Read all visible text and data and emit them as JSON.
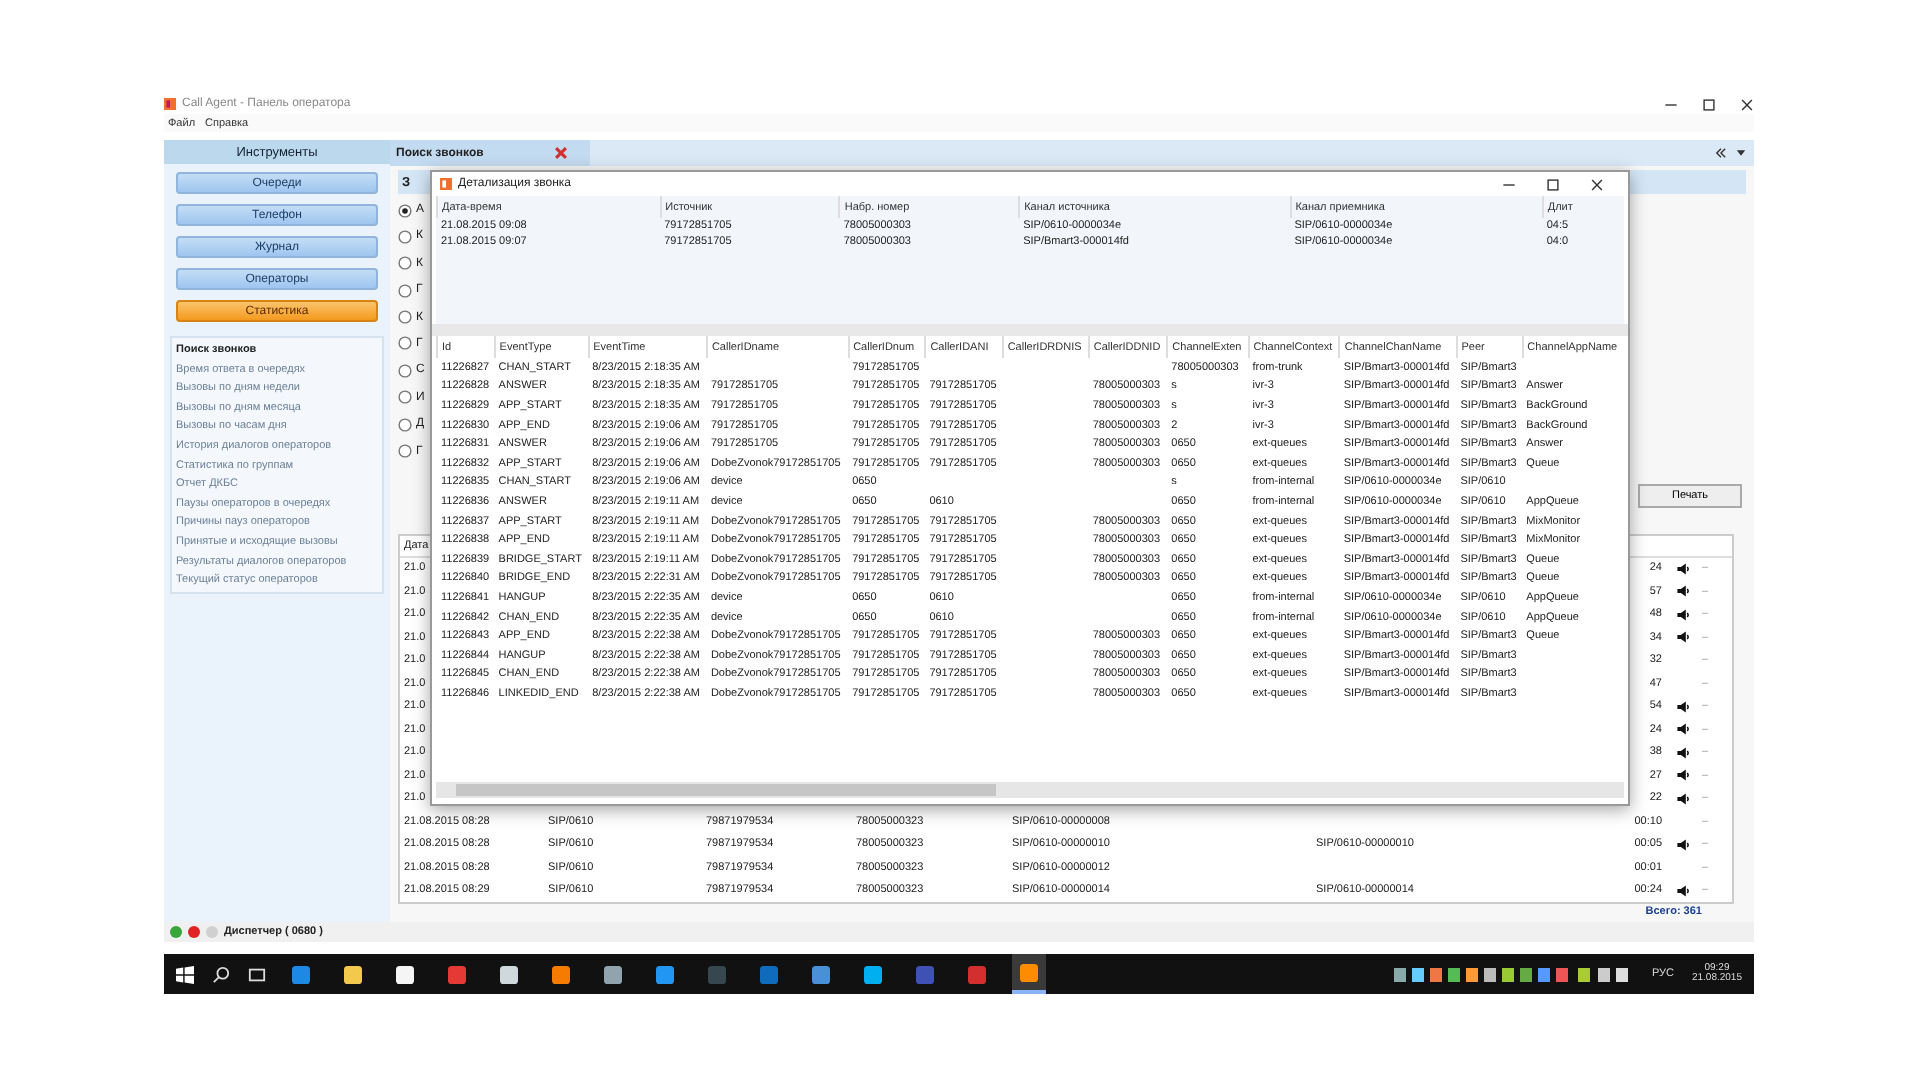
{
  "window": {
    "title": "Call Agent - Панель оператора"
  },
  "menu": [
    {
      "label": "Файл"
    },
    {
      "label": "Справка"
    }
  ],
  "sidebar": {
    "title": "Инструменты",
    "buttons": [
      {
        "label": "Очереди",
        "selected": false
      },
      {
        "label": "Телефон",
        "selected": false
      },
      {
        "label": "Журнал",
        "selected": false
      },
      {
        "label": "Операторы",
        "selected": false
      },
      {
        "label": "Статистика",
        "selected": true
      }
    ],
    "reports": [
      {
        "label": "Поиск звонков",
        "selected": true
      },
      {
        "label": "Время ответа в очередях",
        "selected": false
      },
      {
        "label": "Вызовы по дням недели",
        "selected": false
      },
      {
        "label": "Вызовы по дням месяца",
        "selected": false
      },
      {
        "label": "Вызовы по часам дня",
        "selected": false
      },
      {
        "label": "История диалогов операторов",
        "selected": false
      },
      {
        "label": "Статистика по группам",
        "selected": false
      },
      {
        "label": "Отчет ДКБС",
        "selected": false
      },
      {
        "label": "Паузы операторов в очередях",
        "selected": false
      },
      {
        "label": "Причины пауз операторов",
        "selected": false
      },
      {
        "label": "Принятые и исходящие вызовы",
        "selected": false
      },
      {
        "label": "Результаты диалогов операторов",
        "selected": false
      },
      {
        "label": "Текущий статус операторов",
        "selected": false
      }
    ]
  },
  "tabs": [
    {
      "label": "Поиск звонков",
      "selected": true
    }
  ],
  "search": {
    "heading": "З",
    "options": [
      {
        "label": "А",
        "selected": true
      },
      {
        "label": "К",
        "selected": false
      },
      {
        "label": "К",
        "selected": false
      },
      {
        "label": "Г",
        "selected": false
      },
      {
        "label": "К",
        "selected": false
      },
      {
        "label": "Г",
        "selected": false
      },
      {
        "label": "С",
        "selected": false
      },
      {
        "label": "И",
        "selected": false
      },
      {
        "label": "Д",
        "selected": false
      },
      {
        "label": "Г",
        "selected": false
      }
    ],
    "print_button": "Печать",
    "results": {
      "columns": [
        "Дата"
      ],
      "rows": [
        {
          "date": "21.0",
          "duration": "24",
          "has_audio": true,
          "mark": "–"
        },
        {
          "date": "21.0",
          "duration": "57",
          "has_audio": true,
          "mark": "–"
        },
        {
          "date": "21.0",
          "duration": "48",
          "has_audio": true,
          "mark": "–"
        },
        {
          "date": "21.0",
          "duration": "34",
          "has_audio": true,
          "mark": "–"
        },
        {
          "date": "21.0",
          "duration": "32",
          "has_audio": false,
          "mark": "–"
        },
        {
          "date": "21.0",
          "duration": "47",
          "has_audio": false,
          "mark": "–"
        },
        {
          "date": "21.0",
          "duration": "54",
          "has_audio": true,
          "mark": "–"
        },
        {
          "date": "21.0",
          "duration": "24",
          "has_audio": true,
          "mark": "–"
        },
        {
          "date": "21.0",
          "duration": "38",
          "has_audio": true,
          "mark": "–"
        },
        {
          "date": "21.0",
          "duration": "27",
          "has_audio": true,
          "mark": "–"
        },
        {
          "date": "21.0",
          "duration": "22",
          "has_audio": true,
          "mark": "–"
        },
        {
          "date": "21.08.2015 08:28",
          "source": "SIP/0610",
          "number": "79871979534",
          "dialed": "78005000323",
          "channel": "SIP/0610-00000008",
          "duration": "00:10",
          "has_audio": false,
          "mark": "–"
        },
        {
          "date": "21.08.2015 08:28",
          "source": "SIP/0610",
          "number": "79871979534",
          "dialed": "78005000323",
          "channel": "SIP/0610-00000010",
          "target": "SIP/0610-00000010",
          "duration": "00:05",
          "has_audio": true,
          "mark": "–"
        },
        {
          "date": "21.08.2015 08:28",
          "source": "SIP/0610",
          "number": "79871979534",
          "dialed": "78005000323",
          "channel": "SIP/0610-00000012",
          "duration": "00:01",
          "has_audio": false,
          "mark": "–"
        },
        {
          "date": "21.08.2015 08:29",
          "source": "SIP/0610",
          "number": "79871979534",
          "dialed": "78005000323",
          "channel": "SIP/0610-00000014",
          "target": "SIP/0610-00000014",
          "duration": "00:24",
          "has_audio": true,
          "mark": "–"
        }
      ]
    },
    "total": "Всего: 361"
  },
  "dialog": {
    "title": "Детализация звонка",
    "calls": {
      "columns": [
        "Дата-время",
        "Источник",
        "Набр. номер",
        "Канал источника",
        "Канал приемника",
        "Длит"
      ],
      "rows": [
        [
          "21.08.2015 09:08",
          "79172851705",
          "78005000303",
          "SIP/0610-0000034e",
          "SIP/0610-0000034e",
          "04:5"
        ],
        [
          "21.08.2015 09:07",
          "79172851705",
          "78005000303",
          "SIP/Bmart3-000014fd",
          "SIP/0610-0000034e",
          "04:0"
        ]
      ]
    },
    "events": {
      "columns": [
        "Id",
        "EventType",
        "EventTime",
        "CallerIDname",
        "CallerIDnum",
        "CallerIDANI",
        "CallerIDRDNIS",
        "CallerIDDNID",
        "ChannelExten",
        "ChannelContext",
        "ChannelChanName",
        "Peer",
        "ChannelAppName"
      ],
      "rows": [
        {
          "id": "11226827",
          "type": "CHAN_START",
          "time": "8/23/2015 2:18:35 AM",
          "num": "79172851705",
          "exten": "78005000303",
          "ctx": "from-trunk",
          "chan": "SIP/Bmart3-000014fd",
          "peer": "SIP/Bmart3"
        },
        {
          "id": "11226828",
          "type": "ANSWER",
          "time": "8/23/2015 2:18:35 AM",
          "name": "79172851705",
          "num": "79172851705",
          "ani": "79172851705",
          "dnid": "78005000303",
          "exten": "s",
          "ctx": "ivr-3",
          "chan": "SIP/Bmart3-000014fd",
          "peer": "SIP/Bmart3",
          "app": "Answer"
        },
        {
          "id": "11226829",
          "type": "APP_START",
          "time": "8/23/2015 2:18:35 AM",
          "name": "79172851705",
          "num": "79172851705",
          "ani": "79172851705",
          "dnid": "78005000303",
          "exten": "s",
          "ctx": "ivr-3",
          "chan": "SIP/Bmart3-000014fd",
          "peer": "SIP/Bmart3",
          "app": "BackGround"
        },
        {
          "id": "11226830",
          "type": "APP_END",
          "time": "8/23/2015 2:19:06 AM",
          "name": "79172851705",
          "num": "79172851705",
          "ani": "79172851705",
          "dnid": "78005000303",
          "exten": "2",
          "ctx": "ivr-3",
          "chan": "SIP/Bmart3-000014fd",
          "peer": "SIP/Bmart3",
          "app": "BackGround"
        },
        {
          "id": "11226831",
          "type": "ANSWER",
          "time": "8/23/2015 2:19:06 AM",
          "name": "79172851705",
          "num": "79172851705",
          "ani": "79172851705",
          "dnid": "78005000303",
          "exten": "0650",
          "ctx": "ext-queues",
          "chan": "SIP/Bmart3-000014fd",
          "peer": "SIP/Bmart3",
          "app": "Answer"
        },
        {
          "id": "11226832",
          "type": "APP_START",
          "time": "8/23/2015 2:19:06 AM",
          "name": "DobeZvonok79172851705",
          "num": "79172851705",
          "ani": "79172851705",
          "dnid": "78005000303",
          "exten": "0650",
          "ctx": "ext-queues",
          "chan": "SIP/Bmart3-000014fd",
          "peer": "SIP/Bmart3",
          "app": "Queue"
        },
        {
          "id": "11226835",
          "type": "CHAN_START",
          "time": "8/23/2015 2:19:06 AM",
          "name": "device",
          "num": "0650",
          "exten": "s",
          "ctx": "from-internal",
          "chan": "SIP/0610-0000034e",
          "peer": "SIP/0610"
        },
        {
          "id": "11226836",
          "type": "ANSWER",
          "time": "8/23/2015 2:19:11 AM",
          "name": "device",
          "num": "0650",
          "ani": "0610",
          "exten": "0650",
          "ctx": "from-internal",
          "chan": "SIP/0610-0000034e",
          "peer": "SIP/0610",
          "app": "AppQueue"
        },
        {
          "id": "11226837",
          "type": "APP_START",
          "time": "8/23/2015 2:19:11 AM",
          "name": "DobeZvonok79172851705",
          "num": "79172851705",
          "ani": "79172851705",
          "dnid": "78005000303",
          "exten": "0650",
          "ctx": "ext-queues",
          "chan": "SIP/Bmart3-000014fd",
          "peer": "SIP/Bmart3",
          "app": "MixMonitor"
        },
        {
          "id": "11226838",
          "type": "APP_END",
          "time": "8/23/2015 2:19:11 AM",
          "name": "DobeZvonok79172851705",
          "num": "79172851705",
          "ani": "79172851705",
          "dnid": "78005000303",
          "exten": "0650",
          "ctx": "ext-queues",
          "chan": "SIP/Bmart3-000014fd",
          "peer": "SIP/Bmart3",
          "app": "MixMonitor"
        },
        {
          "id": "11226839",
          "type": "BRIDGE_START",
          "time": "8/23/2015 2:19:11 AM",
          "name": "DobeZvonok79172851705",
          "num": "79172851705",
          "ani": "79172851705",
          "dnid": "78005000303",
          "exten": "0650",
          "ctx": "ext-queues",
          "chan": "SIP/Bmart3-000014fd",
          "peer": "SIP/Bmart3",
          "app": "Queue"
        },
        {
          "id": "11226840",
          "type": "BRIDGE_END",
          "time": "8/23/2015 2:22:31 AM",
          "name": "DobeZvonok79172851705",
          "num": "79172851705",
          "ani": "79172851705",
          "dnid": "78005000303",
          "exten": "0650",
          "ctx": "ext-queues",
          "chan": "SIP/Bmart3-000014fd",
          "peer": "SIP/Bmart3",
          "app": "Queue"
        },
        {
          "id": "11226841",
          "type": "HANGUP",
          "time": "8/23/2015 2:22:35 AM",
          "name": "device",
          "num": "0650",
          "ani": "0610",
          "exten": "0650",
          "ctx": "from-internal",
          "chan": "SIP/0610-0000034e",
          "peer": "SIP/0610",
          "app": "AppQueue"
        },
        {
          "id": "11226842",
          "type": "CHAN_END",
          "time": "8/23/2015 2:22:35 AM",
          "name": "device",
          "num": "0650",
          "ani": "0610",
          "exten": "0650",
          "ctx": "from-internal",
          "chan": "SIP/0610-0000034e",
          "peer": "SIP/0610",
          "app": "AppQueue"
        },
        {
          "id": "11226843",
          "type": "APP_END",
          "time": "8/23/2015 2:22:38 AM",
          "name": "DobeZvonok79172851705",
          "num": "79172851705",
          "ani": "79172851705",
          "dnid": "78005000303",
          "exten": "0650",
          "ctx": "ext-queues",
          "chan": "SIP/Bmart3-000014fd",
          "peer": "SIP/Bmart3",
          "app": "Queue"
        },
        {
          "id": "11226844",
          "type": "HANGUP",
          "time": "8/23/2015 2:22:38 AM",
          "name": "DobeZvonok79172851705",
          "num": "79172851705",
          "ani": "79172851705",
          "dnid": "78005000303",
          "exten": "0650",
          "ctx": "ext-queues",
          "chan": "SIP/Bmart3-000014fd",
          "peer": "SIP/Bmart3"
        },
        {
          "id": "11226845",
          "type": "CHAN_END",
          "time": "8/23/2015 2:22:38 AM",
          "name": "DobeZvonok79172851705",
          "num": "79172851705",
          "ani": "79172851705",
          "dnid": "78005000303",
          "exten": "0650",
          "ctx": "ext-queues",
          "chan": "SIP/Bmart3-000014fd",
          "peer": "SIP/Bmart3"
        },
        {
          "id": "11226846",
          "type": "LINKEDID_END",
          "time": "8/23/2015 2:22:38 AM",
          "name": "DobeZvonok79172851705",
          "num": "79172851705",
          "ani": "79172851705",
          "dnid": "78005000303",
          "exten": "0650",
          "ctx": "ext-queues",
          "chan": "SIP/Bmart3-000014fd",
          "peer": "SIP/Bmart3"
        }
      ]
    }
  },
  "status_bar": {
    "indicators": [
      {
        "color": "#3aa53a"
      },
      {
        "color": "#e02424"
      },
      {
        "color": "#d0d0d0"
      }
    ],
    "text": "Диспетчер ( 0680 )"
  },
  "taskbar": {
    "apps": [
      {
        "color": "#1e88e5",
        "selected": false
      },
      {
        "color": "#f2c94c",
        "selected": false
      },
      {
        "color": "#f5f5f5",
        "selected": false
      },
      {
        "color": "#e53935",
        "selected": false
      },
      {
        "color": "#cfd8dc",
        "selected": false
      },
      {
        "color": "#f57c00",
        "selected": false
      },
      {
        "color": "#90a4ae",
        "selected": false
      },
      {
        "color": "#2196f3",
        "selected": false
      },
      {
        "color": "#37474f",
        "selected": false
      },
      {
        "color": "#0f6cbd",
        "selected": false
      },
      {
        "color": "#4a90d9",
        "selected": false
      },
      {
        "color": "#00aff0",
        "selected": false
      },
      {
        "color": "#3f51b5",
        "selected": false
      },
      {
        "color": "#d32f2f",
        "selected": false
      },
      {
        "color": "#ff8c00",
        "selected": true
      }
    ],
    "language": "РУС",
    "time": "09:29",
    "date": "21.08.2015"
  }
}
